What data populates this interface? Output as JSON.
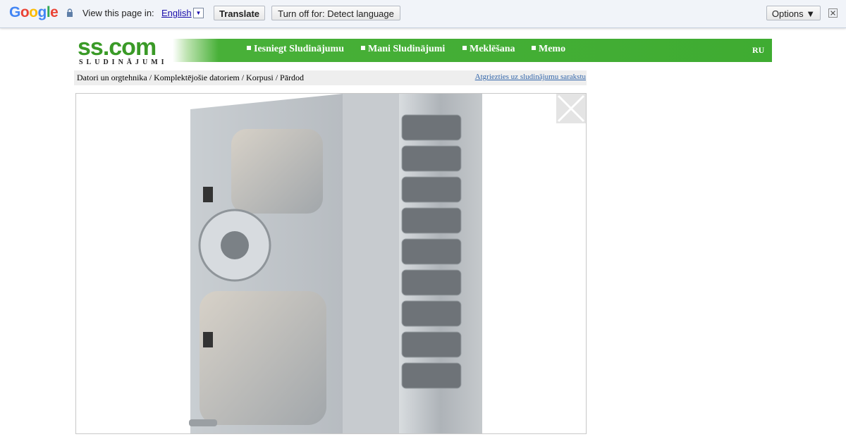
{
  "translate_bar": {
    "logo": "Google",
    "prompt": "View this page in:",
    "language": "English",
    "translate_button": "Translate",
    "turn_off_button": "Turn off for: Detect language",
    "options_button": "Options ▼"
  },
  "site": {
    "logo_main": "ss.com",
    "logo_sub": "SLUDINĀJUMI",
    "menu": [
      {
        "label": "Iesniegt Sludinājumu"
      },
      {
        "label": "Mani Sludinājumi"
      },
      {
        "label": "Meklēšana"
      },
      {
        "label": "Memo"
      }
    ],
    "lang_switch": "RU",
    "accent_color": "#3fac32"
  },
  "breadcrumb": {
    "path": "Datori un orgtehnika / Komplektējošie datoriem / Korpusi / Pārdod",
    "back_link": "Atgriezties uz sludinājumu sarakstu"
  },
  "viewer": {
    "image_subject": "silver-computer-case-photo",
    "close_icon": "close-x-icon"
  }
}
